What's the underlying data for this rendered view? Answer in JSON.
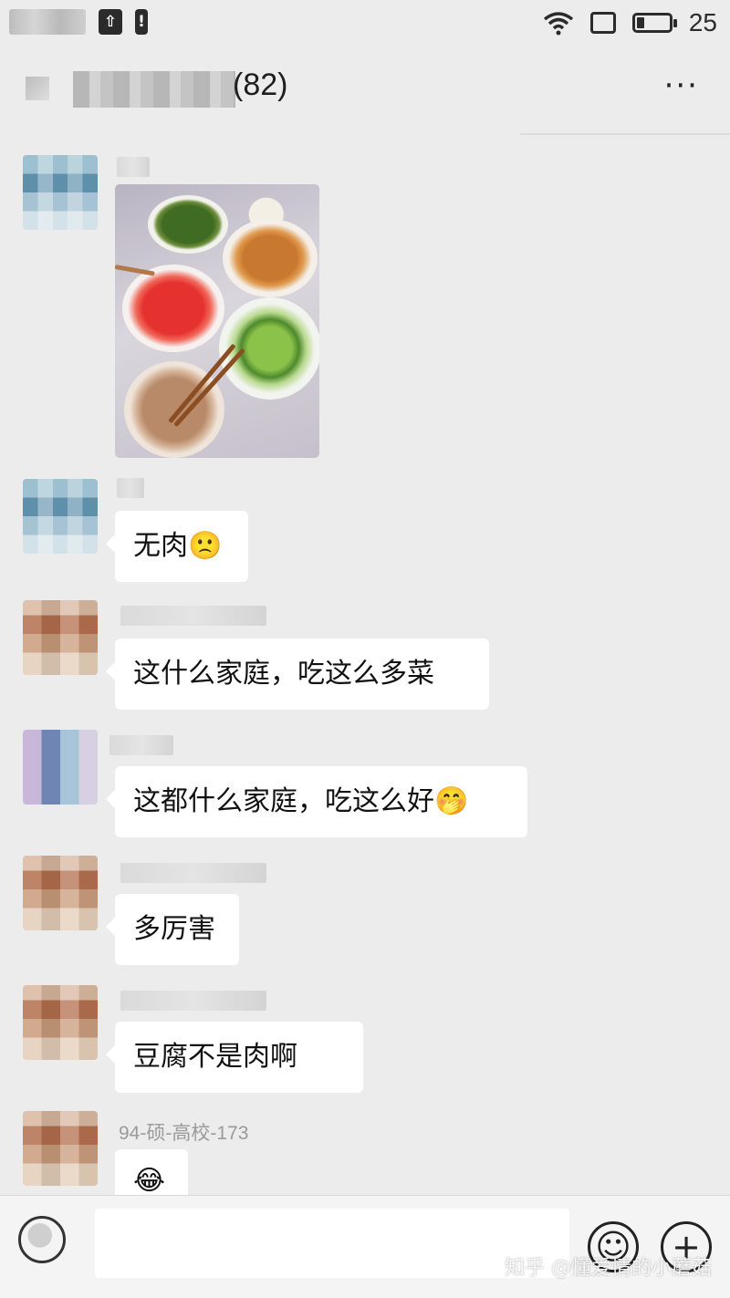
{
  "status_bar": {
    "battery_level": "25",
    "battery_fraction": 0.25,
    "icons": [
      "upload-icon",
      "alert-icon",
      "wifi-icon",
      "square-icon",
      "battery-icon"
    ]
  },
  "header": {
    "title_visible_suffix": "(82)",
    "more_label": "···"
  },
  "messages": [
    {
      "sender_visible": "",
      "type": "image"
    },
    {
      "sender_visible": "",
      "type": "text",
      "text": "无肉",
      "emoji": "🙁"
    },
    {
      "sender_visible": "",
      "type": "text",
      "text": "这什么家庭，吃这么多菜"
    },
    {
      "sender_visible": "",
      "type": "text",
      "text": "这都什么家庭，吃这么好",
      "emoji": "🤭"
    },
    {
      "sender_visible": "",
      "type": "text",
      "text": "多厉害"
    },
    {
      "sender_visible": "",
      "type": "text",
      "text": "豆腐不是肉啊"
    },
    {
      "sender_visible": "94-硕-高校-173",
      "type": "text",
      "emoji": "😂"
    }
  ],
  "input_bar": {
    "emoji_button": "☺",
    "plus_button": "+",
    "watermark": "知乎 @懂爱情的小蘑菇"
  }
}
